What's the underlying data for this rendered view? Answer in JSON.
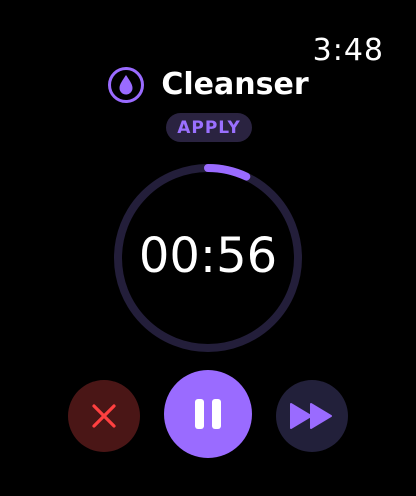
{
  "status_bar": {
    "time": "3:48"
  },
  "header": {
    "title": "Cleanser",
    "icon": "water-drop-icon"
  },
  "tag": {
    "label": "APPLY"
  },
  "timer": {
    "display": "00:56",
    "progress": 0.07
  },
  "controls": {
    "cancel_icon": "x-icon",
    "pause_icon": "pause-icon",
    "skip_icon": "fast-forward-icon"
  },
  "colors": {
    "background": "#000000",
    "accent": "#9a6bff",
    "ring_track": "#231e3a",
    "tag_bg": "#2a2340",
    "cancel_bg": "#4a1616",
    "cancel_icon": "#ff4040",
    "skip_bg": "#22203a"
  }
}
